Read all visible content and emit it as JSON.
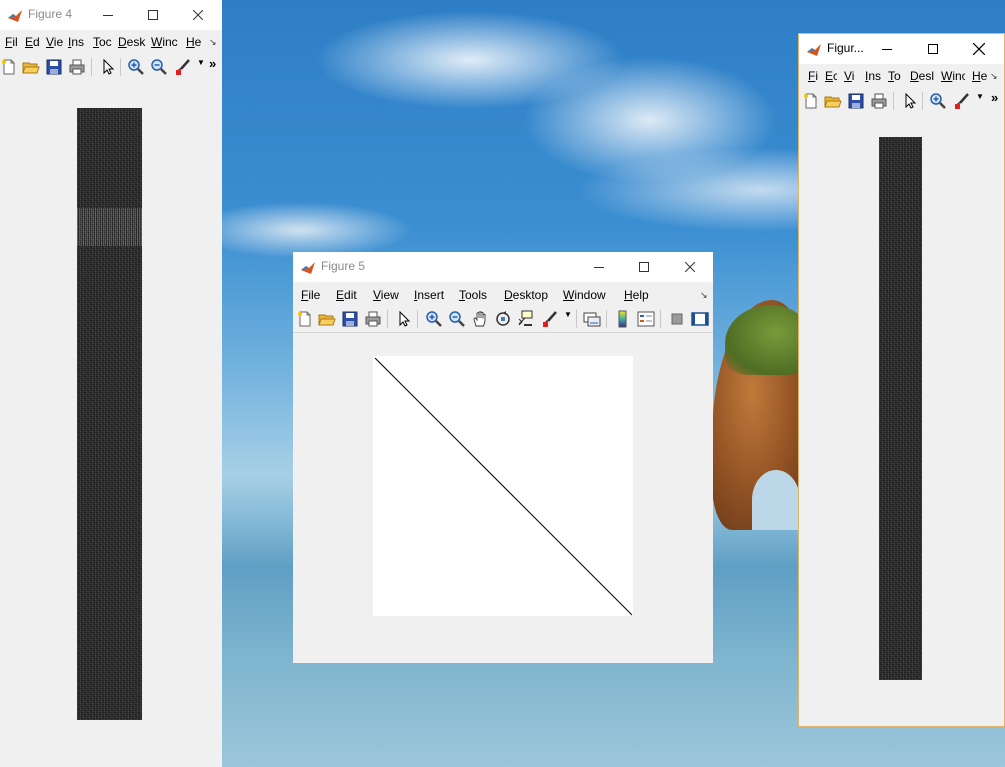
{
  "windows": {
    "figure4": {
      "title": "Figure 4",
      "menu": [
        "Fil",
        "Ed",
        "Vie",
        "Ins",
        "Toc",
        "Desk",
        "Winc",
        "He"
      ]
    },
    "figure5": {
      "title": "Figure 5",
      "menu": [
        "File",
        "Edit",
        "View",
        "Insert",
        "Tools",
        "Desktop",
        "Window",
        "Help"
      ]
    },
    "figure_right": {
      "title": "Figur...",
      "menu": [
        "Fi",
        "Ec",
        "Vi",
        "Ins",
        "To",
        "Desl",
        "Winc",
        "He"
      ]
    }
  },
  "icons": {
    "app": "matlab-logo-icon",
    "minimize": "minimize-icon",
    "maximize": "maximize-icon",
    "close": "close-icon",
    "more": "chevron-double-right-icon",
    "dock": "dock-arrow-icon"
  },
  "symbols": {
    "more": "»",
    "dock": "↘"
  },
  "colors": {
    "title_inactive": "#8a8a8a",
    "window_bg": "#f0f0f0",
    "axes_bg": "#ffffff"
  }
}
